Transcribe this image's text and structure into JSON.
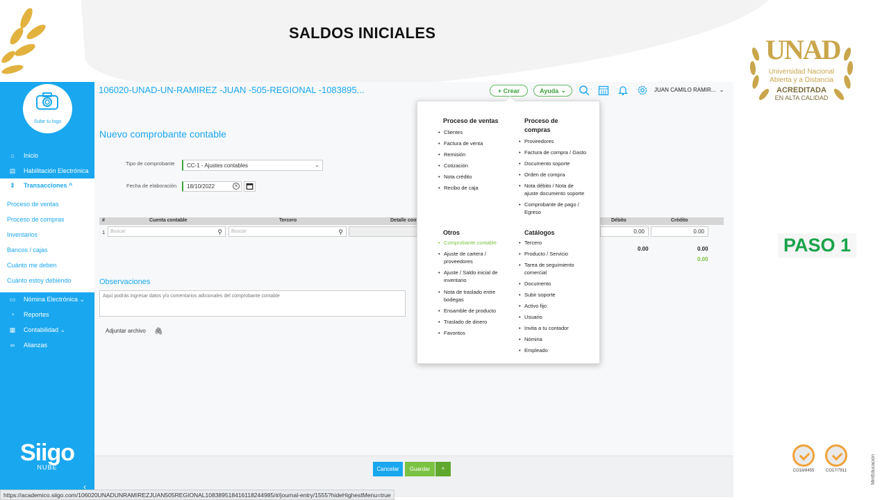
{
  "slide": {
    "title": "SALDOS INICIALES",
    "step": "PASO 1",
    "unad": {
      "letters": "UNAD",
      "line1": "Universidad Nacional",
      "line2": "Abierta y a Distancia",
      "line3": "ACREDITADA",
      "line4": "EN ALTA CALIDAD"
    },
    "certs": [
      {
        "code": "CO18/8455"
      },
      {
        "code": "CO17/7811"
      }
    ],
    "vertical_mark": "MinEducación"
  },
  "app": {
    "account_title": "106020-UNAD-UN-RAMIREZ -JUAN -505-REGIONAL -1083895...",
    "header": {
      "create_label": "+ Crear",
      "help_label": "Ayuda",
      "user_name": "JUAN CAMILO RAMIR..."
    },
    "sidebar": {
      "logo_label": "Sube tu logo",
      "items": [
        {
          "label": "Inicio",
          "icon": "home-icon"
        },
        {
          "label": "Habilitación Electrónica",
          "icon": "document-icon"
        },
        {
          "label": "Transacciones ^",
          "icon": "transactions-icon"
        },
        {
          "label": "Nómina Electrónica ⌄",
          "icon": "payroll-icon"
        },
        {
          "label": "Reportes",
          "icon": "reports-icon"
        },
        {
          "label": "Contabilidad ⌄",
          "icon": "accounting-icon"
        },
        {
          "label": "Alianzas",
          "icon": "link-icon"
        }
      ],
      "submenu": [
        "Proceso de ventas",
        "Proceso de compras",
        "Inventarios",
        "Bancos / cajas",
        "Cuánto me deben",
        "Cuánto estoy debiendo"
      ],
      "brand": "Siigo",
      "brand_sub": "NUBE"
    },
    "form": {
      "title": "Nuevo comprobante contable",
      "type_label": "Tipo de comprobante",
      "type_value": "CC-1 - Ajustes contables",
      "date_label": "Fecha de elaboración",
      "date_value": "18/10/2022"
    },
    "table": {
      "headers": {
        "num": "#",
        "account": "Cuenta contable",
        "third": "Tercero",
        "detail": "Detalle cont",
        "debit": "Débito",
        "credit": "Crédito"
      },
      "row": {
        "num": "1",
        "account_placeholder": "Buscar",
        "third_placeholder": "Buscar",
        "debit": "0.00",
        "credit": "0.00"
      },
      "totals": {
        "debit": "0.00",
        "credit": "0.00",
        "difference": "0.00"
      }
    },
    "observations": {
      "title": "Observaciones",
      "placeholder": "Aquí podrás ingresar datos y/o comentarios adicionales del comprobante contable"
    },
    "attach_label": "Adjuntar archivo",
    "footer": {
      "cancel": "Cancelar",
      "save": "Guardar",
      "caret": "^"
    },
    "menu": {
      "sales": {
        "title": "Proceso de ventas",
        "items": [
          "Clientes",
          "Factura de venta",
          "Remisión",
          "Cotización",
          "Nota crédito",
          "Recibo de caja"
        ]
      },
      "purchases": {
        "title_line1": "Proceso de",
        "title_line2": "compras",
        "items": [
          [
            "Proveedores"
          ],
          [
            "Factura de compra / Gasto"
          ],
          [
            "Documento soporte"
          ],
          [
            "Orden de compra"
          ],
          [
            "Nota débito / Nota de",
            "ajuste documento soporte"
          ],
          [
            "Comprobante de pago /",
            "Egreso"
          ]
        ]
      },
      "others": {
        "title": "Otros",
        "items": [
          [
            "Comprobante contable"
          ],
          [
            "Ajuste de cartera /",
            "proveedores"
          ],
          [
            "Ajuste / Saldo inicial de",
            "inventario"
          ],
          [
            "Nota de traslado entre",
            "bodegas"
          ],
          [
            "Ensamble de producto"
          ],
          [
            "Traslado de dinero"
          ],
          [
            "Favoritos"
          ]
        ]
      },
      "catalogs": {
        "title": "Catálogos",
        "items": [
          [
            "Tercero"
          ],
          [
            "Producto / Servicio"
          ],
          [
            "Tarea de seguimiento",
            "comercial"
          ],
          [
            "Documento"
          ],
          [
            "Subir soporte"
          ],
          [
            "Activo fijo"
          ],
          [
            "Usuario"
          ],
          [
            "Invita a tu contador"
          ],
          [
            "Nómina"
          ],
          [
            "Empleado"
          ]
        ]
      }
    }
  },
  "status_url": "https://academico.siigo.com/106020UNADUNRAMIREZJUAN505REGIONAL1083895184161182449‌85/#/journal-entry/1555?hideHighestMenu=true",
  "colors": {
    "brand_blue": "#19a7ef",
    "brand_green": "#7cc242",
    "step_green": "#1aa34a",
    "unad_gold": "#c9a64c"
  }
}
